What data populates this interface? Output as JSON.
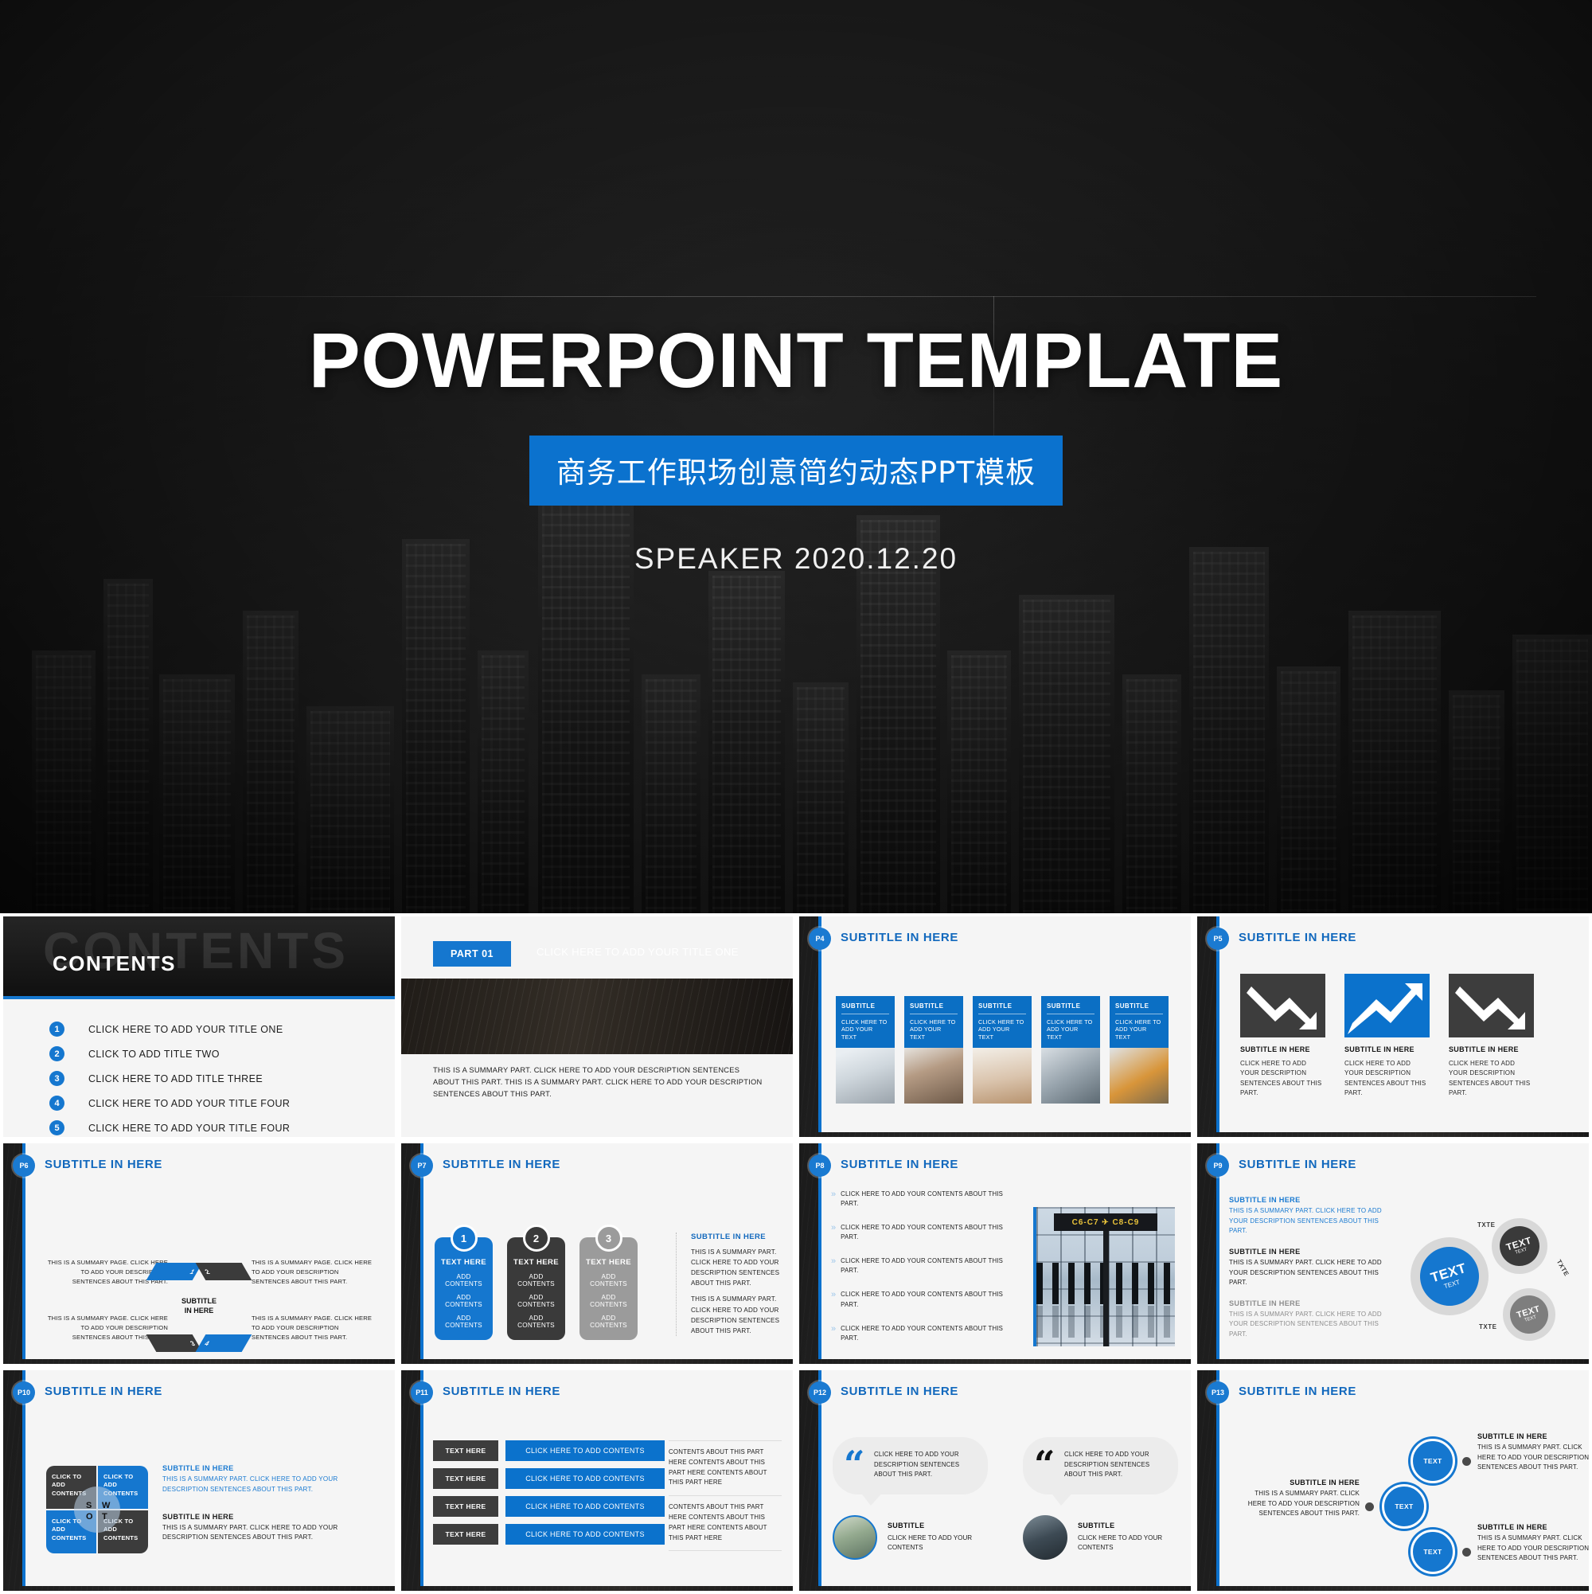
{
  "hero": {
    "title": "POWERPOINT TEMPLATE",
    "badge": "商务工作职场创意简约动态PPT模板",
    "speaker": "SPEAKER  2020.12.20"
  },
  "colors": {
    "accent_blue": "#1577cf",
    "card_blue": "#0b6fc4",
    "dark": "#3d3d3d",
    "gray": "#9b9b9b"
  },
  "common": {
    "subtitle_in_here": "SUBTITLE IN HERE",
    "summary_part": "THIS IS A SUMMARY PART. CLICK HERE TO ADD YOUR DESCRIPTION SENTENCES ABOUT THIS PART.",
    "summary_page": "THIS IS A SUMMARY PAGE. CLICK HERE TO ADD YOUR DESCRIPTION SENTENCES ABOUT THIS PART.",
    "click_add_desc": "CLICK HERE TO ADD YOUR DESCRIPTION SENTENCES ABOUT THIS PART.",
    "click_contents": "CLICK HERE TO ADD YOUR CONTENTS ABOUT THIS PART.",
    "text_here": "TEXT HERE",
    "add_contents": "ADD CONTENTS",
    "click_to_add_contents": "CLICK TO ADD CONTENTS",
    "click_add_your_text": "CLICK HERE TO ADD YOUR TEXT",
    "subtitle": "SUBTITLE",
    "text": "TEXT",
    "txte": "TXTE"
  },
  "slides": [
    {
      "page": "",
      "title": "CONTENTS",
      "ghost": "CONTENTS",
      "items": [
        {
          "num": "1",
          "label": "CLICK HERE TO ADD YOUR TITLE ONE"
        },
        {
          "num": "2",
          "label": "CLICK TO ADD TITLE TWO"
        },
        {
          "num": "3",
          "label": "CLICK HERE TO ADD TITLE THREE"
        },
        {
          "num": "4",
          "label": "CLICK HERE TO ADD  YOUR TITLE FOUR"
        },
        {
          "num": "5",
          "label": "CLICK HERE TO ADD  YOUR TITLE FOUR"
        }
      ]
    },
    {
      "page": "",
      "chip": "PART 01",
      "band_title": "CLICK HERE TO ADD YOUR TITLE ONE",
      "summary": "THIS IS A SUMMARY PART. CLICK HERE TO ADD YOUR DESCRIPTION SENTENCES ABOUT THIS PART. THIS IS A SUMMARY PART. CLICK HERE TO ADD YOUR DESCRIPTION  SENTENCES ABOUT THIS PART."
    },
    {
      "page": "P4",
      "title": "SUBTITLE IN HERE",
      "cards": [
        {
          "head": "SUBTITLE",
          "body": "CLICK HERE TO ADD YOUR TEXT",
          "img": "laptop-desk-photo"
        },
        {
          "head": "SUBTITLE",
          "body": "CLICK HERE TO ADD YOUR TEXT",
          "img": "two-women-meeting-photo"
        },
        {
          "head": "SUBTITLE",
          "body": "CLICK HERE TO ADD YOUR TEXT",
          "img": "hand-notebook-photo"
        },
        {
          "head": "SUBTITLE",
          "body": "CLICK HERE TO ADD YOUR TEXT",
          "img": "hands-typing-photo"
        },
        {
          "head": "SUBTITLE",
          "body": "CLICK HERE TO ADD YOUR TEXT",
          "img": "desk-folders-photo"
        }
      ]
    },
    {
      "page": "P5",
      "title": "SUBTITLE IN HERE",
      "tiles": [
        {
          "icon": "arrow-down-chart-icon",
          "color": "dark",
          "head": "SUBTITLE IN HERE",
          "body": "CLICK HERE TO ADD YOUR DESCRIPTION SENTENCES ABOUT THIS PART."
        },
        {
          "icon": "arrow-up-chart-icon",
          "color": "blue",
          "head": "SUBTITLE IN HERE",
          "body": "CLICK HERE TO ADD YOUR DESCRIPTION SENTENCES ABOUT THIS PART."
        },
        {
          "icon": "arrow-down-chart-icon",
          "color": "dark",
          "head": "SUBTITLE IN HERE",
          "body": "CLICK HERE TO ADD YOUR DESCRIPTION SENTENCES ABOUT THIS PART."
        }
      ]
    },
    {
      "page": "P6",
      "title": "SUBTITLE IN HERE",
      "hex_center": "SUBTITLE\nIN HERE",
      "hex_center_l1": "SUBTITLE",
      "hex_center_l2": "IN HERE",
      "segments": [
        "1",
        "2",
        "3",
        "4"
      ],
      "texts": [
        "THIS IS A SUMMARY PAGE. CLICK HERE TO ADD YOUR DESCRIPTION SENTENCES ABOUT THIS PART.",
        "THIS IS A SUMMARY PAGE. CLICK HERE TO ADD YOUR DESCRIPTION SENTENCES ABOUT THIS PART.",
        "THIS IS A SUMMARY PAGE. CLICK HERE TO ADD YOUR DESCRIPTION SENTENCES ABOUT THIS PART.",
        "THIS IS A SUMMARY PAGE. CLICK HERE TO ADD YOUR DESCRIPTION SENTENCES ABOUT THIS PART."
      ]
    },
    {
      "page": "P7",
      "title": "SUBTITLE IN HERE",
      "cards": [
        {
          "num": "1",
          "head": "TEXT HERE",
          "lines": [
            "ADD CONTENTS",
            "ADD CONTENTS",
            "ADD CONTENTS"
          ]
        },
        {
          "num": "2",
          "head": "TEXT HERE",
          "lines": [
            "ADD CONTENTS",
            "ADD CONTENTS",
            "ADD CONTENTS"
          ]
        },
        {
          "num": "3",
          "head": "TEXT HERE",
          "lines": [
            "ADD CONTENTS",
            "ADD CONTENTS",
            "ADD CONTENTS"
          ]
        }
      ],
      "right_title": "SUBTITLE IN HERE",
      "right_p1": "THIS IS A SUMMARY PART. CLICK HERE TO ADD YOUR DESCRIPTION SENTENCES ABOUT THIS PART.",
      "right_p2": "THIS IS A SUMMARY PART. CLICK HERE TO ADD YOUR DESCRIPTION SENTENCES ABOUT THIS PART."
    },
    {
      "page": "P8",
      "title": "SUBTITLE IN HERE",
      "bullets": [
        "CLICK HERE TO ADD YOUR CONTENTS ABOUT THIS PART.",
        "CLICK HERE TO ADD YOUR CONTENTS ABOUT THIS PART.",
        "CLICK HERE TO ADD YOUR CONTENTS ABOUT THIS PART.",
        "CLICK HERE TO ADD YOUR CONTENTS ABOUT THIS PART.",
        "CLICK HERE TO ADD YOUR CONTENTS ABOUT THIS PART."
      ],
      "photo_sign": "C6-C7 ✈ C8-C9",
      "photo_name": "airport-terminal-silhouettes-photo"
    },
    {
      "page": "P9",
      "title": "SUBTITLE IN HERE",
      "blocks": [
        {
          "head": "SUBTITLE IN HERE",
          "body": "THIS IS A SUMMARY PART. CLICK HERE TO ADD YOUR DESCRIPTION SENTENCES ABOUT THIS PART."
        },
        {
          "head": "SUBTITLE IN HERE",
          "body": "THIS IS A SUMMARY PART. CLICK HERE TO ADD YOUR DESCRIPTION SENTENCES ABOUT THIS PART."
        },
        {
          "head": "SUBTITLE IN HERE",
          "body": "THIS IS A SUMMARY PART. CLICK HERE TO ADD YOUR DESCRIPTION SENTENCES ABOUT THIS PART."
        }
      ],
      "gears": [
        {
          "big": "TEXT",
          "small": "TEXT",
          "color": "#1577cf"
        },
        {
          "big": "TEXT",
          "small": "TEXT",
          "color": "#3a3a3a"
        },
        {
          "big": "TEXT",
          "small": "TEXT",
          "color": "#7e7e7e"
        }
      ],
      "arrow_labels": [
        "TXTE",
        "TXTE",
        "TXTE"
      ]
    },
    {
      "page": "P10",
      "title": "SUBTITLE IN HERE",
      "quadrants": [
        {
          "letter": "S",
          "text": "CLICK TO ADD CONTENTS",
          "color": "dark"
        },
        {
          "letter": "W",
          "text": "CLICK TO ADD CONTENTS",
          "color": "blue"
        },
        {
          "letter": "O",
          "text": "CLICK TO ADD CONTENTS",
          "color": "blue"
        },
        {
          "letter": "T",
          "text": "CLICK TO ADD CONTENTS",
          "color": "dark"
        }
      ],
      "blocks": [
        {
          "head": "SUBTITLE IN HERE",
          "body": "THIS IS A SUMMARY PART. CLICK HERE TO ADD YOUR DESCRIPTION SENTENCES ABOUT THIS PART."
        },
        {
          "head": "SUBTITLE IN HERE",
          "body": "THIS IS A SUMMARY PART. CLICK HERE TO ADD YOUR DESCRIPTION SENTENCES ABOUT THIS PART."
        }
      ]
    },
    {
      "page": "P11",
      "title": "SUBTITLE IN HERE",
      "rows": [
        {
          "tag": "TEXT HERE",
          "bar": "CLICK HERE TO ADD CONTENTS"
        },
        {
          "tag": "TEXT HERE",
          "bar": "CLICK HERE TO ADD CONTENTS"
        },
        {
          "tag": "TEXT HERE",
          "bar": "CLICK HERE TO ADD CONTENTS"
        },
        {
          "tag": "TEXT HERE",
          "bar": "CLICK HERE TO ADD CONTENTS"
        }
      ],
      "side": [
        "CONTENTS ABOUT THIS PART HERE CONTENTS ABOUT THIS PART HERE CONTENTS ABOUT THIS PART HERE",
        "CONTENTS ABOUT THIS PART HERE CONTENTS ABOUT THIS PART HERE CONTENTS ABOUT THIS PART HERE"
      ]
    },
    {
      "page": "P12",
      "title": "SUBTITLE IN HERE",
      "quotes": [
        {
          "mark": "“",
          "text": "CLICK HERE TO ADD YOUR DESCRIPTION SENTENCES ABOUT THIS PART.",
          "name": "SUBTITLE",
          "sub": "CLICK HERE TO ADD YOUR CONTENTS",
          "avatar": "aerial-landscape-photo"
        },
        {
          "mark": "“",
          "text": "CLICK HERE TO ADD YOUR DESCRIPTION SENTENCES ABOUT THIS PART.",
          "name": "SUBTITLE",
          "sub": "CLICK HERE TO ADD YOUR CONTENTS",
          "avatar": "night-river-photo"
        }
      ]
    },
    {
      "page": "P13",
      "title": "SUBTITLE IN HERE",
      "nodes": [
        {
          "label": "TEXT",
          "head": "SUBTITLE IN HERE",
          "body": "THIS IS A SUMMARY PART. CLICK HERE TO ADD YOUR DESCRIPTION SENTENCES ABOUT THIS PART."
        },
        {
          "label": "TEXT",
          "head": "SUBTITLE IN HERE",
          "body": "THIS IS A SUMMARY PART. CLICK HERE TO ADD YOUR DESCRIPTION SENTENCES ABOUT THIS PART."
        },
        {
          "label": "TEXT",
          "head": "SUBTITLE IN HERE",
          "body": "THIS IS A SUMMARY PART. CLICK HERE TO ADD YOUR DESCRIPTION SENTENCES ABOUT THIS PART."
        }
      ]
    }
  ]
}
